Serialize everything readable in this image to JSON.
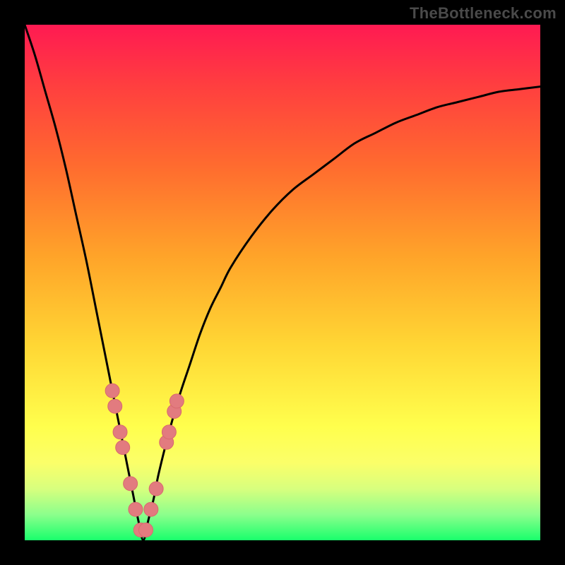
{
  "watermark": "TheBottleneck.com",
  "colors": {
    "curve_stroke": "#000000",
    "marker_fill": "#e27b7f",
    "marker_stroke": "#d86a6e",
    "frame": "#000000"
  },
  "chart_data": {
    "type": "line",
    "title": "",
    "xlabel": "",
    "ylabel": "",
    "xlim": [
      0,
      100
    ],
    "ylim": [
      0,
      100
    ],
    "x_min_at": 23,
    "series": [
      {
        "name": "bottleneck-curve",
        "x": [
          0,
          2,
          4,
          6,
          8,
          10,
          12,
          14,
          16,
          18,
          20,
          21,
          22,
          23,
          24,
          25,
          26,
          28,
          30,
          32,
          34,
          36,
          38,
          40,
          44,
          48,
          52,
          56,
          60,
          64,
          68,
          72,
          76,
          80,
          84,
          88,
          92,
          96,
          100
        ],
        "y": [
          100,
          94,
          87,
          80,
          72,
          63,
          54,
          44,
          34,
          24,
          14,
          9,
          4,
          0,
          4,
          8,
          13,
          21,
          28,
          34,
          40,
          45,
          49,
          53,
          59,
          64,
          68,
          71,
          74,
          77,
          79,
          81,
          82.5,
          84,
          85,
          86,
          87,
          87.5,
          88
        ]
      }
    ],
    "markers": {
      "name": "highlight-points",
      "points": [
        {
          "x": 17.0,
          "y": 29
        },
        {
          "x": 17.5,
          "y": 26
        },
        {
          "x": 18.5,
          "y": 21
        },
        {
          "x": 19.0,
          "y": 18
        },
        {
          "x": 20.5,
          "y": 11
        },
        {
          "x": 21.5,
          "y": 6
        },
        {
          "x": 22.5,
          "y": 2
        },
        {
          "x": 23.5,
          "y": 2
        },
        {
          "x": 24.5,
          "y": 6
        },
        {
          "x": 25.5,
          "y": 10
        },
        {
          "x": 27.5,
          "y": 19
        },
        {
          "x": 28.0,
          "y": 21
        },
        {
          "x": 29.0,
          "y": 25
        },
        {
          "x": 29.5,
          "y": 27
        }
      ]
    }
  }
}
